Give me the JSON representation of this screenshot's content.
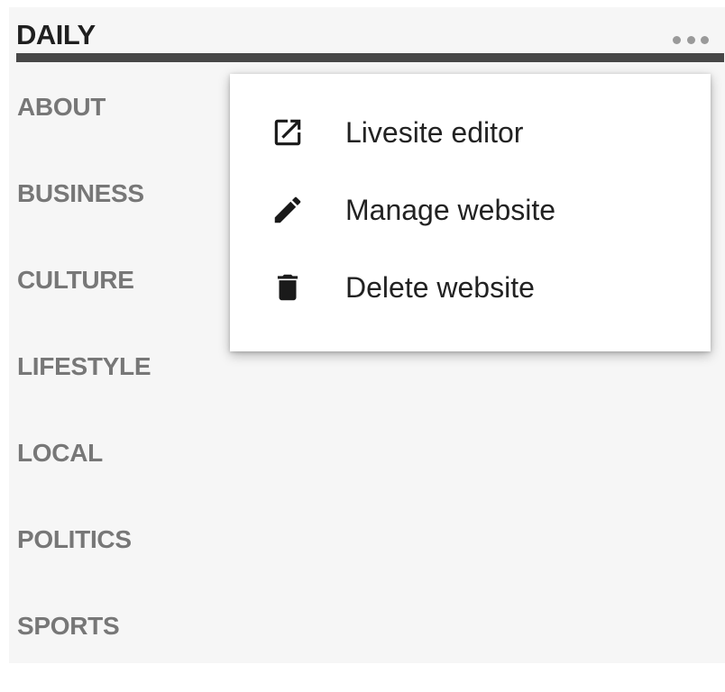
{
  "header": {
    "title": "DAILY",
    "more_icon": "more-horizontal-icon"
  },
  "nav": {
    "items": [
      {
        "label": "ABOUT"
      },
      {
        "label": "BUSINESS"
      },
      {
        "label": "CULTURE"
      },
      {
        "label": "LIFESTYLE"
      },
      {
        "label": "LOCAL"
      },
      {
        "label": "POLITICS"
      },
      {
        "label": "SPORTS"
      }
    ]
  },
  "menu": {
    "items": [
      {
        "label": "Livesite editor",
        "icon": "open-in-new-icon"
      },
      {
        "label": "Manage website",
        "icon": "pencil-icon"
      },
      {
        "label": "Delete website",
        "icon": "trash-icon"
      }
    ]
  },
  "colors": {
    "panel_bg": "#f6f6f6",
    "header_rule": "#474747",
    "title_text": "#1f1f1f",
    "nav_text": "#777777",
    "menu_text": "#222222",
    "icon": "#1a1a1a"
  }
}
